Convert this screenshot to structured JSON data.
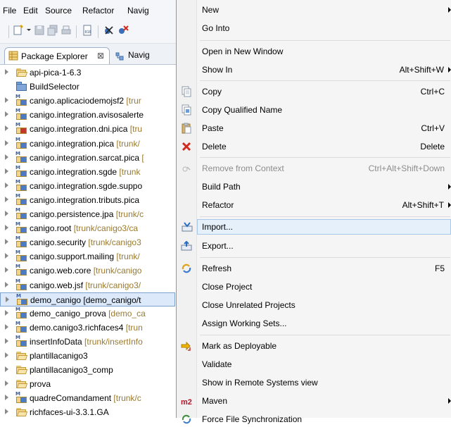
{
  "menubar": {
    "file": "File",
    "edit": "Edit",
    "source": "Source",
    "refactor": "Refactor",
    "navigate": "Navig"
  },
  "tabs": {
    "package_explorer": "Package Explorer",
    "close_glyph": "⊠",
    "navigator": "Navig"
  },
  "tree": {
    "items": [
      {
        "name": "api-pica-1-6.3",
        "suffix": "",
        "icon": "folder-icon"
      },
      {
        "name": "BuildSelector",
        "suffix": "",
        "icon": "project-icon"
      },
      {
        "name": "canigo.aplicaciodemojsf2",
        "suffix": " [trur",
        "icon": "maven-project-icon"
      },
      {
        "name": "canigo.integration.avisosalerte",
        "suffix": "",
        "icon": "maven-project-icon"
      },
      {
        "name": "canigo.integration.dni.pica",
        "suffix": " [tru",
        "icon": "maven-project-error-icon"
      },
      {
        "name": "canigo.integration.pica",
        "suffix": " [trunk/",
        "icon": "maven-project-icon"
      },
      {
        "name": "canigo.integration.sarcat.pica",
        "suffix": " [",
        "icon": "maven-project-icon"
      },
      {
        "name": "canigo.integration.sgde",
        "suffix": " [trunk",
        "icon": "maven-project-icon"
      },
      {
        "name": "canigo.integration.sgde.suppo",
        "suffix": "",
        "icon": "maven-project-icon"
      },
      {
        "name": "canigo.integration.tributs.pica",
        "suffix": "",
        "icon": "maven-project-icon"
      },
      {
        "name": "canigo.persistence.jpa",
        "suffix": " [trunk/c",
        "icon": "maven-project-icon"
      },
      {
        "name": "canigo.root",
        "suffix": " [trunk/canigo3/ca",
        "icon": "maven-project-icon"
      },
      {
        "name": "canigo.security",
        "suffix": " [trunk/canigo3",
        "icon": "maven-project-icon"
      },
      {
        "name": "canigo.support.mailing",
        "suffix": " [trunk/",
        "icon": "maven-project-icon"
      },
      {
        "name": "canigo.web.core",
        "suffix": " [trunk/canigo",
        "icon": "maven-project-icon"
      },
      {
        "name": "canigo.web.jsf",
        "suffix": " [trunk/canigo3/",
        "icon": "maven-project-icon"
      },
      {
        "name": "demo_canigo [demo_canigo/t",
        "suffix": "",
        "icon": "maven-project-icon",
        "selected": true
      },
      {
        "name": "demo_canigo_prova",
        "suffix": " [demo_ca",
        "icon": "maven-project-icon"
      },
      {
        "name": "demo.canigo3.richfaces4",
        "suffix": " [trun",
        "icon": "maven-project-icon"
      },
      {
        "name": "insertInfoData",
        "suffix": " [trunk/insertInfo",
        "icon": "maven-project-icon"
      },
      {
        "name": "plantillacanigo3",
        "suffix": "",
        "icon": "folder-icon"
      },
      {
        "name": "plantillacanigo3_comp",
        "suffix": "",
        "icon": "folder-icon"
      },
      {
        "name": "prova",
        "suffix": "",
        "icon": "folder-icon"
      },
      {
        "name": "quadreComandament",
        "suffix": " [trunk/c",
        "icon": "maven-project-icon"
      },
      {
        "name": "richfaces-ui-3.3.1.GA",
        "suffix": "",
        "icon": "folder-icon"
      }
    ]
  },
  "menu": {
    "items": [
      {
        "label": "New",
        "shortcut": "",
        "submenu": true,
        "icon": ""
      },
      {
        "label": "Go Into",
        "shortcut": "",
        "submenu": false,
        "icon": ""
      },
      {
        "label": "Open in New Window",
        "shortcut": "",
        "submenu": false,
        "icon": ""
      },
      {
        "label": "Show In",
        "shortcut": "Alt+Shift+W",
        "submenu": true,
        "icon": ""
      },
      {
        "label": "Copy",
        "shortcut": "Ctrl+C",
        "submenu": false,
        "icon": "copy-icon"
      },
      {
        "label": "Copy Qualified Name",
        "shortcut": "",
        "submenu": false,
        "icon": "copy-qualified-icon"
      },
      {
        "label": "Paste",
        "shortcut": "Ctrl+V",
        "submenu": false,
        "icon": "paste-icon"
      },
      {
        "label": "Delete",
        "shortcut": "Delete",
        "submenu": false,
        "icon": "delete-icon"
      },
      {
        "label": "Remove from Context",
        "shortcut": "Ctrl+Alt+Shift+Down",
        "submenu": false,
        "icon": "remove-context-icon",
        "disabled": true
      },
      {
        "label": "Build Path",
        "shortcut": "",
        "submenu": true,
        "icon": ""
      },
      {
        "label": "Refactor",
        "shortcut": "Alt+Shift+T",
        "submenu": true,
        "icon": ""
      },
      {
        "label": "Import...",
        "shortcut": "",
        "submenu": false,
        "icon": "import-icon",
        "highlighted": true
      },
      {
        "label": "Export...",
        "shortcut": "",
        "submenu": false,
        "icon": "export-icon"
      },
      {
        "label": "Refresh",
        "shortcut": "F5",
        "submenu": false,
        "icon": "refresh-icon"
      },
      {
        "label": "Close Project",
        "shortcut": "",
        "submenu": false,
        "icon": ""
      },
      {
        "label": "Close Unrelated Projects",
        "shortcut": "",
        "submenu": false,
        "icon": ""
      },
      {
        "label": "Assign Working Sets...",
        "shortcut": "",
        "submenu": false,
        "icon": ""
      },
      {
        "label": "Mark as Deployable",
        "shortcut": "",
        "submenu": false,
        "icon": "deploy-icon"
      },
      {
        "label": "Validate",
        "shortcut": "",
        "submenu": false,
        "icon": ""
      },
      {
        "label": "Show in Remote Systems view",
        "shortcut": "",
        "submenu": false,
        "icon": ""
      },
      {
        "label": "Maven",
        "shortcut": "",
        "submenu": true,
        "icon": "maven-m2-icon",
        "icon_text": "m2"
      },
      {
        "label": "Force File Synchronization",
        "shortcut": "",
        "submenu": false,
        "icon": "sync-icon"
      }
    ]
  }
}
